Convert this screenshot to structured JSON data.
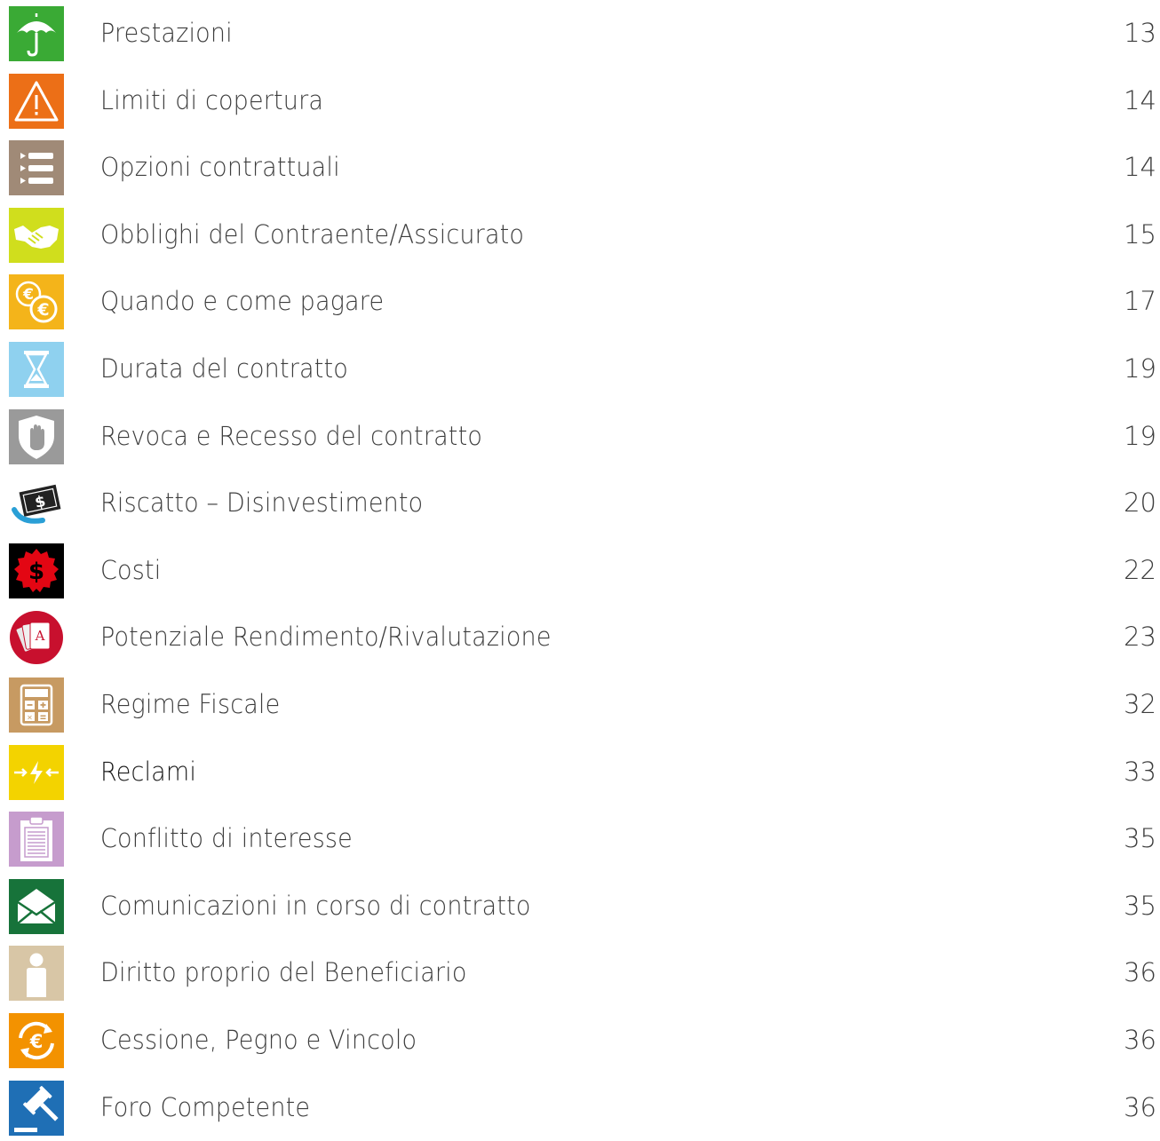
{
  "toc": {
    "items": [
      {
        "label": "Prestazioni",
        "page": "13",
        "icon": "umbrella-icon",
        "color": "#3aaa35"
      },
      {
        "label": "Limiti di copertura",
        "page": "14",
        "icon": "warning-icon",
        "color": "#ec6f17"
      },
      {
        "label": "Opzioni contrattuali",
        "page": "14",
        "icon": "list-icon",
        "color": "#a08a77"
      },
      {
        "label": "Obblighi del Contraente/Assicurato",
        "page": "15",
        "icon": "handshake-icon",
        "color": "#d0de1d"
      },
      {
        "label": "Quando e come pagare",
        "page": "17",
        "icon": "euro-coins-icon",
        "color": "#f4b41a"
      },
      {
        "label": "Durata del contratto",
        "page": "19",
        "icon": "hourglass-icon",
        "color": "#8fd1ef"
      },
      {
        "label": "Revoca e Recesso del contratto",
        "page": "19",
        "icon": "shield-hand-icon",
        "color": "#9a9a9a"
      },
      {
        "label": "Riscatto – Disinvestimento",
        "page": "20",
        "icon": "money-icon",
        "color": "#2a9fd6"
      },
      {
        "label": "Costi",
        "page": "22",
        "icon": "dollar-badge-icon",
        "color": "#e30613"
      },
      {
        "label": "Potenziale Rendimento/Rivalutazione",
        "page": "23",
        "icon": "cards-icon",
        "color": "#c8102e"
      },
      {
        "label": "Regime Fiscale",
        "page": "32",
        "icon": "calculator-icon",
        "color": "#c79a62"
      },
      {
        "label": "Reclami",
        "page": "33",
        "icon": "bolt-arrows-icon",
        "color": "#f3d300"
      },
      {
        "label": "Conflitto di interesse",
        "page": "35",
        "icon": "clipboard-icon",
        "color": "#c69ccd"
      },
      {
        "label": "Comunicazioni in corso di contratto",
        "page": "35",
        "icon": "envelope-icon",
        "color": "#17733a"
      },
      {
        "label": "Diritto proprio del Beneficiario",
        "page": "36",
        "icon": "person-icon",
        "color": "#d8c6a6"
      },
      {
        "label": "Cessione, Pegno e Vincolo",
        "page": "36",
        "icon": "euro-cycle-icon",
        "color": "#f39200"
      },
      {
        "label": "Foro Competente",
        "page": "36",
        "icon": "gavel-icon",
        "color": "#1f6fb5"
      }
    ]
  }
}
